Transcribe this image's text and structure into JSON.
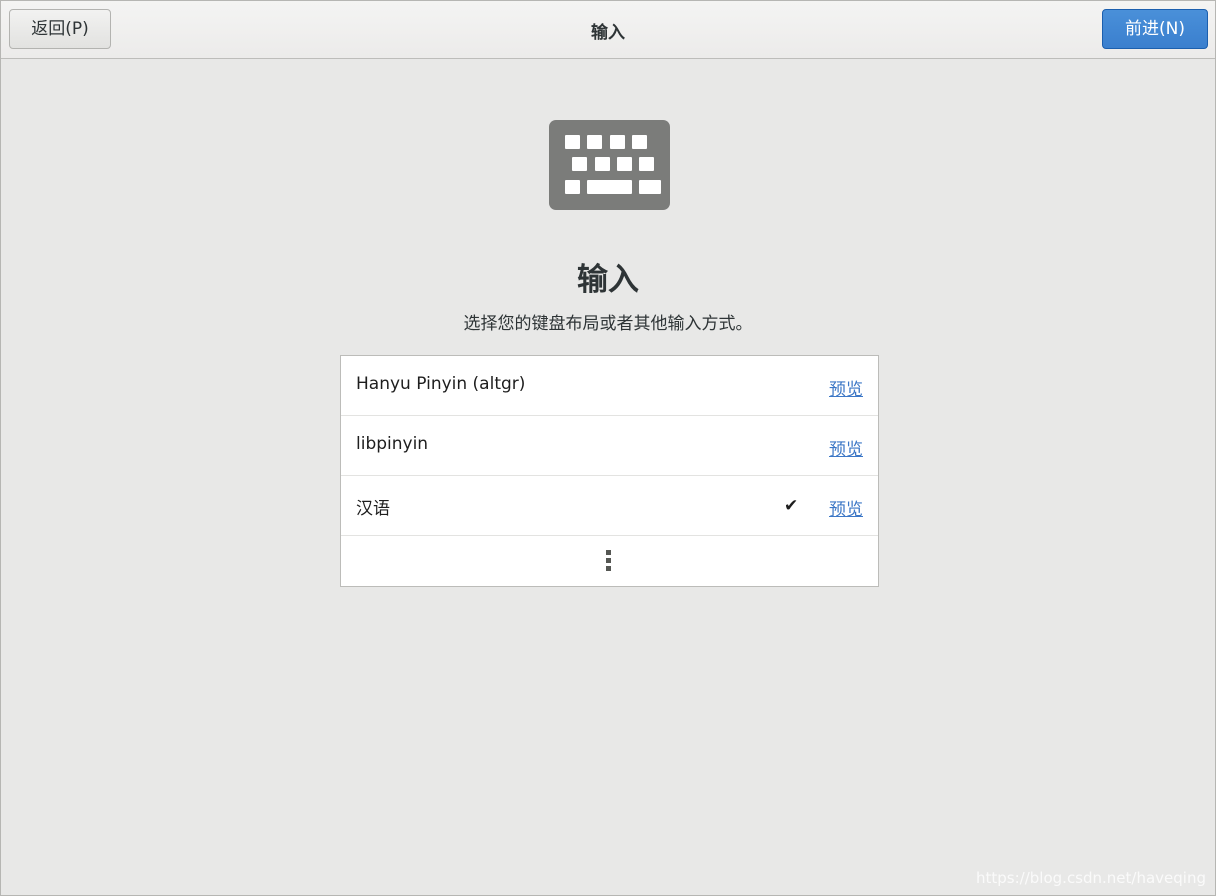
{
  "header": {
    "back_label": "返回(P)",
    "title": "输入",
    "next_label": "前进(N)"
  },
  "page": {
    "icon": "keyboard-icon",
    "title": "输入",
    "subtitle": "选择您的键盘布局或者其他输入方式。"
  },
  "input_sources": [
    {
      "name": "Hanyu Pinyin (altgr)",
      "preview_label": "预览",
      "selected": false
    },
    {
      "name": "libpinyin",
      "preview_label": "预览",
      "selected": false
    },
    {
      "name": "汉语",
      "preview_label": "预览",
      "selected": true,
      "check_mark": "✔"
    }
  ],
  "more_icon": "more-vertical-icon",
  "watermark": "https://blog.csdn.net/haveqing",
  "colors": {
    "accent": "#3a7fce",
    "link": "#3c77c6",
    "background": "#e8e8e7"
  }
}
